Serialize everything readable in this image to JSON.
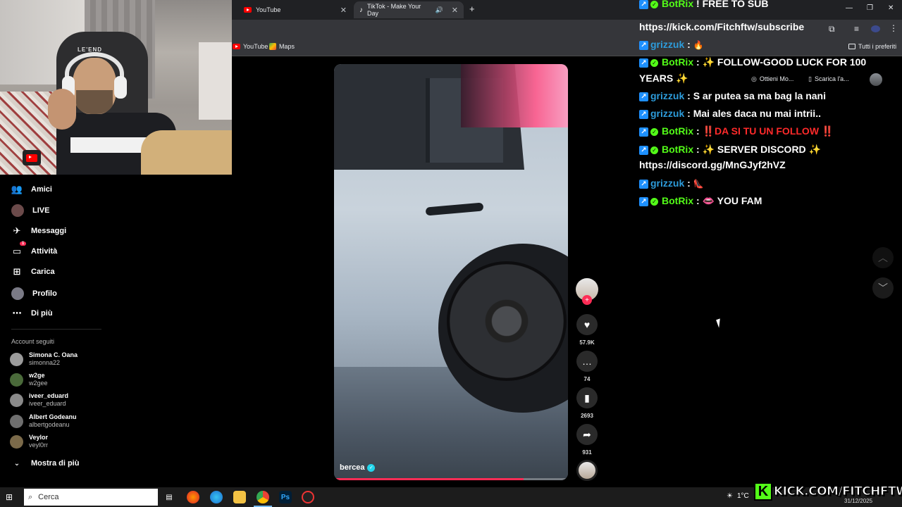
{
  "browser": {
    "tabs": [
      {
        "label": "YouTube",
        "icon": "youtube-icon"
      },
      {
        "label": "TikTok - Make Your Day",
        "icon": "tiktok-icon"
      }
    ],
    "bookmarks": [
      {
        "label": "YouTube",
        "icon": "youtube-icon"
      },
      {
        "label": "Maps",
        "icon": "maps-icon"
      }
    ],
    "all_bookmarks_label": "Tutti i preferiti",
    "chips": [
      "Ottieni Mo...",
      "Scarica l'a..."
    ]
  },
  "sidebar": {
    "items": [
      {
        "label": "Amici",
        "icon": "friends-icon"
      },
      {
        "label": "LIVE",
        "icon": "live-icon"
      },
      {
        "label": "Messaggi",
        "icon": "messages-icon"
      },
      {
        "label": "Attività",
        "icon": "activity-icon",
        "badge": "1"
      },
      {
        "label": "Carica",
        "icon": "upload-icon"
      },
      {
        "label": "Profilo",
        "icon": "profile-icon"
      },
      {
        "label": "Di più",
        "icon": "more-icon"
      }
    ],
    "following_title": "Account seguiti",
    "following": [
      {
        "name": "Simona C. Oana",
        "user": "simonna22"
      },
      {
        "name": "w2ge",
        "user": "w2gee"
      },
      {
        "name": "iveer_eduard",
        "user": "iveer_eduard"
      },
      {
        "name": "Albert Godeanu",
        "user": "albertgodeanu"
      },
      {
        "name": "Veylor",
        "user": "veyl0rr"
      }
    ],
    "show_more": "Mostra di più"
  },
  "video": {
    "author": "bercea",
    "progress": 0.81,
    "likes": "57.9K",
    "comments": "74",
    "saves": "2693",
    "shares": "931"
  },
  "chat": {
    "messages": [
      {
        "user": "BotRix",
        "text": "! FREE TO SUB"
      },
      {
        "user": "",
        "text": "https://kick.com/Fitchftw/subscribe"
      },
      {
        "user": "grizzuk",
        "text": "🔥"
      },
      {
        "user": "BotRix",
        "text": "✨ FOLLOW-GOOD LUCK FOR 100"
      },
      {
        "user": "",
        "text": "YEARS ✨"
      },
      {
        "user": "grizzuk",
        "text": "S ar putea sa ma bag la nani"
      },
      {
        "user": "grizzuk",
        "text": "Mai ales daca nu mai intrii.."
      },
      {
        "user": "BotRix",
        "text": "‼️DA SI TU UN FOLLOW ‼️"
      },
      {
        "user": "BotRix",
        "text": "✨ SERVER DISCORD ✨"
      },
      {
        "user": "",
        "text": "https://discord.gg/MnGJyf2hVZ"
      },
      {
        "user": "grizzuk",
        "text": "👠"
      },
      {
        "user": "BotRix",
        "text": "👄 YOU FAM"
      }
    ]
  },
  "taskbar": {
    "search_placeholder": "Cerca",
    "weather": "1°C",
    "date": "31/12/2025"
  },
  "watermark": {
    "text": "KICK.COM/FITCHFTW",
    "letter": "K"
  }
}
